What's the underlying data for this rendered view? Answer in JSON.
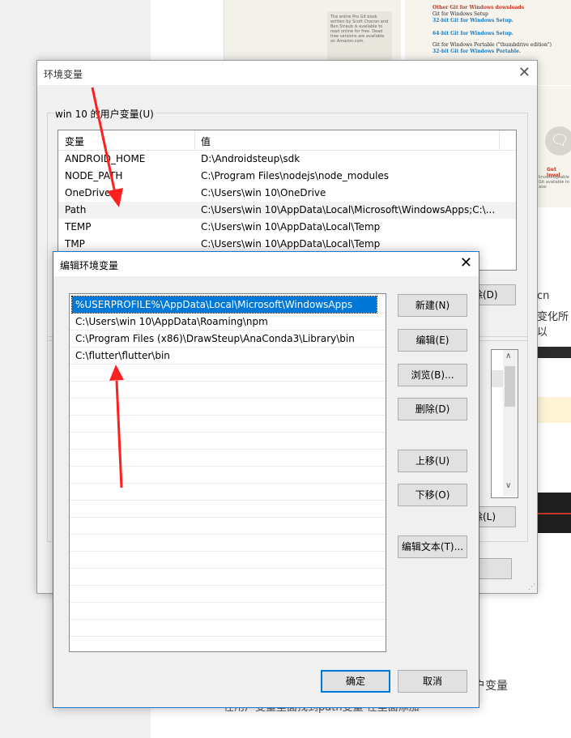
{
  "background": {
    "book_card_text": "The entire Pro Git book written by Scott Chacon and Ben Straub is available to read online for free. Dead tree versions are available on Amazon.com.",
    "downloads": {
      "title": "Other Git for Windows downloads",
      "setup": "Git for Windows Setup",
      "setup32": "32-bit Git for Windows Setup.",
      "setup64": "64-bit Git for Windows Setup.",
      "portable": "Git for Windows Portable (\"thumbdrive edition\")",
      "portable32": "32-bit Git for Windows Portable."
    },
    "involve_title": "Get Invol",
    "involve_text": "knowledgeable Git available to assi",
    "side_text1": "cn",
    "side_text2": "变化所以",
    "bottom_text1": "户变量",
    "bottom_text2": "在用户变量里面找到path变量 在里面添加"
  },
  "env_dialog": {
    "title": "环境变量",
    "user_group_label": "win 10 的用户变量(U)",
    "columns": [
      "变量",
      "值"
    ],
    "rows": [
      {
        "name": "ANDROID_HOME",
        "value": "D:\\Androidsteup\\sdk"
      },
      {
        "name": "NODE_PATH",
        "value": "C:\\Program Files\\nodejs\\node_modules"
      },
      {
        "name": "OneDrive",
        "value": "C:\\Users\\win 10\\OneDrive"
      },
      {
        "name": "Path",
        "value": "C:\\Users\\win 10\\AppData\\Local\\Microsoft\\WindowsApps;C:\\..."
      },
      {
        "name": "TEMP",
        "value": "C:\\Users\\win 10\\AppData\\Local\\Temp"
      },
      {
        "name": "TMP",
        "value": "C:\\Users\\win 10\\AppData\\Local\\Temp"
      }
    ],
    "delete_user_btn": "除(D)",
    "delete_sys_btn": "除(L)",
    "cancel_btn": "消"
  },
  "edit_dialog": {
    "title": "编辑环境变量",
    "paths": [
      "%USERPROFILE%\\AppData\\Local\\Microsoft\\WindowsApps",
      "C:\\Users\\win 10\\AppData\\Roaming\\npm",
      "C:\\Program Files (x86)\\DrawSteup\\AnaConda3\\Library\\bin",
      "C:\\flutter\\flutter\\bin"
    ],
    "buttons": {
      "new": "新建(N)",
      "edit": "编辑(E)",
      "browse": "浏览(B)...",
      "delete": "删除(D)",
      "move_up": "上移(U)",
      "move_down": "下移(O)",
      "edit_text": "编辑文本(T)..."
    },
    "ok": "确定",
    "cancel": "取消"
  },
  "colors": {
    "selection": "#0078d7",
    "arrow": "#ff2020"
  }
}
